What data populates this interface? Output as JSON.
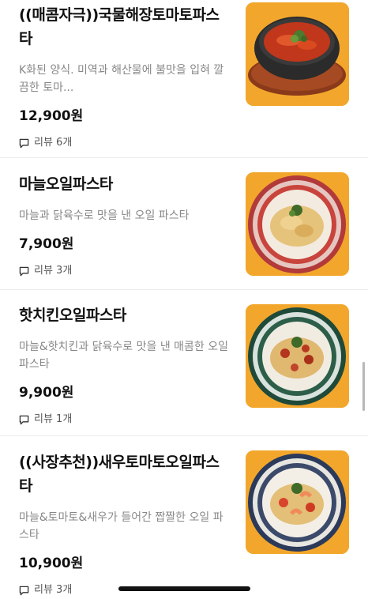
{
  "menu_items": [
    {
      "name": "((매콤자극))국물해장토마토파스타",
      "description": "K화된 양식. 미역과 해산물에 불맛을 입혀 깔끔한 토마...",
      "price": "12,900원",
      "review_label": "리뷰 6개",
      "image_icon": "tomato-soup-pasta-photo"
    },
    {
      "name": "마늘오일파스타",
      "description": "마늘과 닭육수로 맛을 낸 오일 파스타",
      "price": "7,900원",
      "review_label": "리뷰 3개",
      "image_icon": "garlic-oil-pasta-photo"
    },
    {
      "name": "핫치킨오일파스타",
      "description": "마늘&핫치킨과 닭육수로 맛을 낸 매콤한 오일 파스타",
      "price": "9,900원",
      "review_label": "리뷰 1개",
      "image_icon": "hot-chicken-pasta-photo"
    },
    {
      "name": "((사장추천))새우토마토오일파스타",
      "description": "마늘&토마토&새우가 들어간 짭짤한 오일 파스타",
      "price": "10,900원",
      "review_label": "리뷰 3개",
      "image_icon": "shrimp-tomato-pasta-photo"
    }
  ],
  "colors": {
    "thumb_bg": "#f2a72c",
    "divider": "#ececec"
  }
}
